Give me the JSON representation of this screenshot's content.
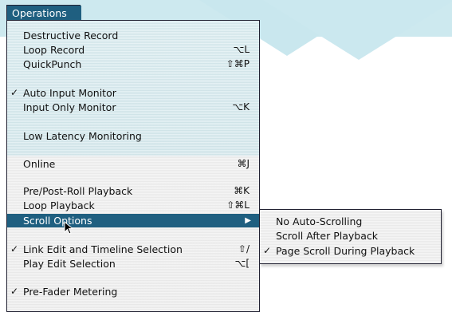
{
  "colors": {
    "accent": "#1f5f80",
    "menu_background_top": "#d4e8ed",
    "menu_background_bottom": "#eeeeee",
    "canvas_tint": "#cde9ef"
  },
  "menubar": {
    "title": "Operations"
  },
  "menu": {
    "items": [
      {
        "label": "Destructive Record",
        "shortcut": "",
        "checked": false
      },
      {
        "label": "Loop Record",
        "shortcut": "⌥L",
        "checked": false
      },
      {
        "label": "QuickPunch",
        "shortcut": "⇧⌘P",
        "checked": false
      },
      {
        "label": "Auto Input Monitor",
        "shortcut": "",
        "checked": true
      },
      {
        "label": "Input Only Monitor",
        "shortcut": "⌥K",
        "checked": false
      },
      {
        "label": "Low Latency Monitoring",
        "shortcut": "",
        "checked": false
      },
      {
        "label": "Online",
        "shortcut": "⌘J",
        "checked": false
      },
      {
        "label": "Pre/Post-Roll Playback",
        "shortcut": "⌘K",
        "checked": false
      },
      {
        "label": "Loop Playback",
        "shortcut": "⇧⌘L",
        "checked": false
      },
      {
        "label": "Scroll Options",
        "shortcut": "",
        "checked": false,
        "submenu": true,
        "highlighted": true,
        "arrow": "▶"
      },
      {
        "label": "Link Edit and Timeline Selection",
        "shortcut": "⇧/",
        "checked": true
      },
      {
        "label": "Play Edit Selection",
        "shortcut": "⌥[",
        "checked": false
      },
      {
        "label": "Pre-Fader Metering",
        "shortcut": "",
        "checked": true
      }
    ],
    "check_glyph": "✓"
  },
  "submenu": {
    "items": [
      {
        "label": "No Auto-Scrolling",
        "checked": false
      },
      {
        "label": "Scroll After Playback",
        "checked": false
      },
      {
        "label": "Page Scroll During Playback",
        "checked": true
      }
    ]
  },
  "icons": {
    "cursor": "arrow-cursor-icon"
  }
}
